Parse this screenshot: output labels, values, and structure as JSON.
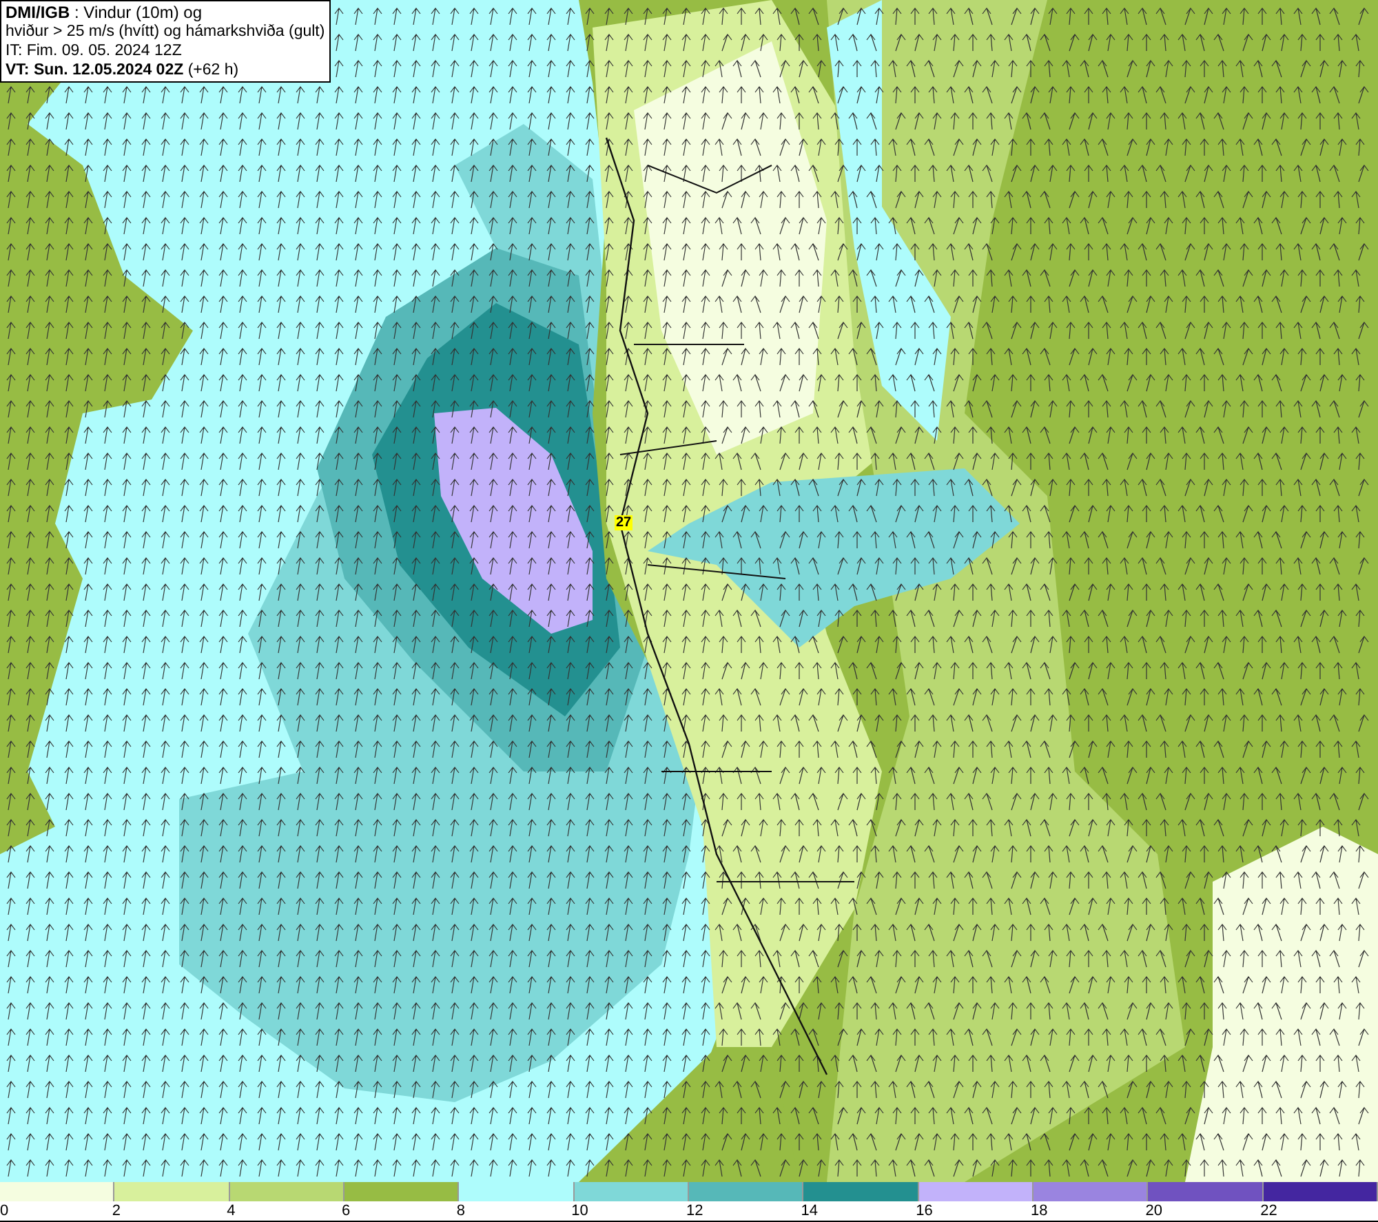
{
  "title_box": {
    "lines": [
      "**DMI/IGB** : Vindur (10m) og",
      "hviður > 25 m/s (hvítt) og hámarkshviða (gult)",
      "IT: Fim. 09. 05. 2024 12Z",
      "**VT: Sun. 12.05.2024 02Z** (+62 h)"
    ]
  },
  "map": {
    "gust_marker": "27"
  },
  "legend": [
    {
      "label": "0",
      "color": "#f5fde0"
    },
    {
      "label": "2",
      "color": "#d8f09c"
    },
    {
      "label": "4",
      "color": "#b8d872"
    },
    {
      "label": "6",
      "color": "#97bc44"
    },
    {
      "label": "8",
      "color": "#aefcfc"
    },
    {
      "label": "10",
      "color": "#7fd8d8"
    },
    {
      "label": "12",
      "color": "#56b8b8"
    },
    {
      "label": "14",
      "color": "#239090"
    },
    {
      "label": "16",
      "color": "#c2b2fa"
    },
    {
      "label": "18",
      "color": "#9a84e0"
    },
    {
      "label": "20",
      "color": "#7052c0"
    },
    {
      "label": "22",
      "color": "#4426a0"
    }
  ]
}
